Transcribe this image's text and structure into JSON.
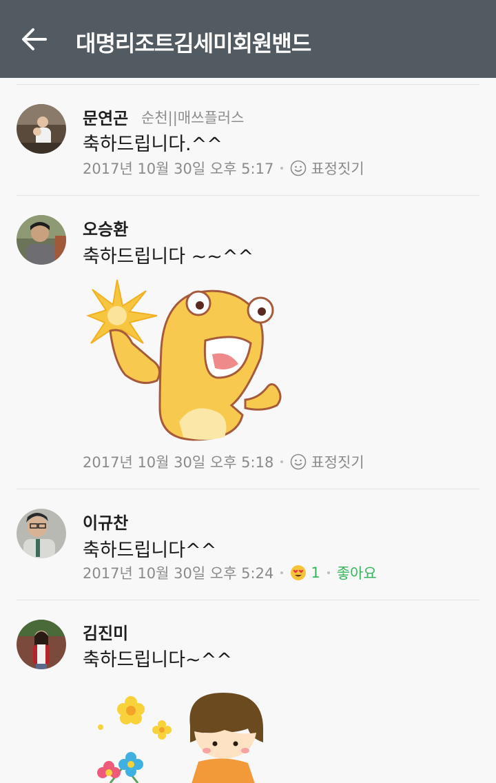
{
  "header": {
    "title": "대명리조트김세미회원밴드"
  },
  "comments": [
    {
      "name": "문연곤",
      "tag": "순천||매쓰플러스",
      "text": "축하드립니다.^^",
      "time": "2017년 10월 30일 오후 5:17",
      "react_label": "표정짓기"
    },
    {
      "name": "오승환",
      "text": "축하드립니다 ~~^^",
      "time": "2017년 10월 30일 오후 5:18",
      "react_label": "표정짓기"
    },
    {
      "name": "이규찬",
      "text": "축하드립니다^^",
      "time": "2017년 10월 30일 오후 5:24",
      "reaction_count": "1",
      "like_label": "좋아요"
    },
    {
      "name": "김진미",
      "text": "축하드립니다~^^"
    }
  ],
  "colors": {
    "appbar": "#525a62",
    "like_green": "#36b55b",
    "background": "#f8f8f9"
  }
}
